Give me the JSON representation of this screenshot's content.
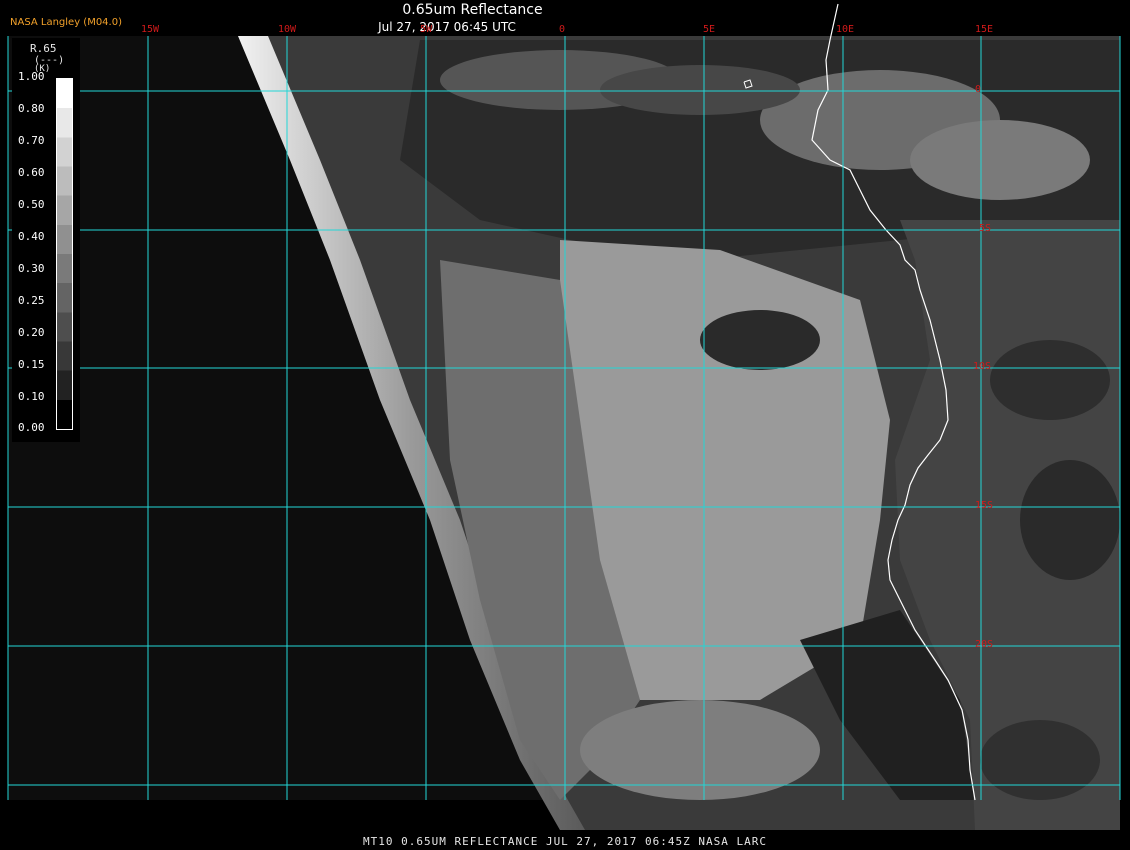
{
  "header": {
    "source": "NASA Langley (M04.0)",
    "title": "0.65um Reflectance",
    "subtitle": "Jul 27, 2017 06:45 UTC"
  },
  "longitude_labels": [
    "15W",
    "10W",
    "5W",
    "0",
    "5E",
    "10E",
    "15E"
  ],
  "latitude_labels": [
    "0",
    "5S",
    "10S",
    "15S",
    "20S"
  ],
  "legend": {
    "title": "R.65",
    "unit": "(---)",
    "k": "(K)",
    "ticks": [
      "1.00",
      "0.80",
      "0.70",
      "0.60",
      "0.50",
      "0.40",
      "0.30",
      "0.25",
      "0.20",
      "0.15",
      "0.10",
      "0.00"
    ]
  },
  "footer": "MT10  0.65UM REFLECTANCE   JUL 27, 2017 06:45Z   NASA LARC",
  "colors": {
    "grid": "#22d6d6",
    "label": "#d01a1a",
    "coastline": "#ffffff",
    "header_source": "#f2a12a"
  }
}
